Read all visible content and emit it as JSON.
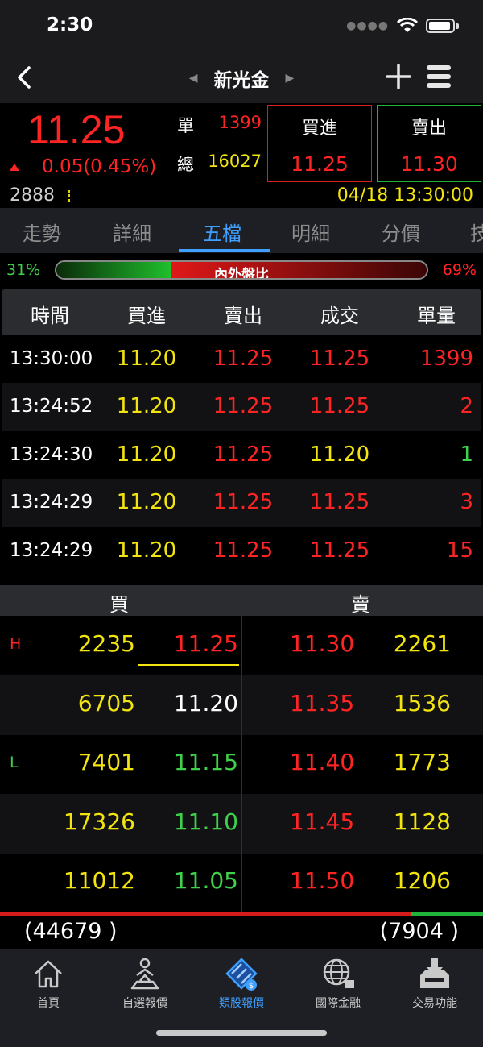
{
  "status": {
    "time": "2:30"
  },
  "header": {
    "title": "新光金"
  },
  "quote": {
    "price": "11.25",
    "change": "0.05(0.45%)",
    "code": "2888",
    "single_label": "單",
    "single_value": "1399",
    "total_label": "總",
    "total_value": "16027",
    "buy_label": "買進",
    "buy_value": "11.25",
    "sell_label": "賣出",
    "sell_value": "11.30",
    "datetime": "04/18 13:30:00"
  },
  "tabs": [
    "走勢",
    "詳細",
    "五檔",
    "明細",
    "分價",
    "技"
  ],
  "active_tab": "五檔",
  "ratio": {
    "inner": "31%",
    "outer": "69%",
    "label": "內外盤比",
    "inner_fraction": 0.31
  },
  "table": {
    "headers": [
      "時間",
      "買進",
      "賣出",
      "成交",
      "單量"
    ],
    "rows": [
      {
        "time": "13:30:00",
        "buy": "11.20",
        "sell": "11.25",
        "deal": "11.25",
        "deal_color": "#ff2424",
        "vol": "1399",
        "vol_color": "#ff2424"
      },
      {
        "time": "13:24:52",
        "buy": "11.20",
        "sell": "11.25",
        "deal": "11.25",
        "deal_color": "#ff2424",
        "vol": "2",
        "vol_color": "#ff2424"
      },
      {
        "time": "13:24:30",
        "buy": "11.20",
        "sell": "11.25",
        "deal": "11.20",
        "deal_color": "#f2e40f",
        "vol": "1",
        "vol_color": "#3fd14a"
      },
      {
        "time": "13:24:29",
        "buy": "11.20",
        "sell": "11.25",
        "deal": "11.25",
        "deal_color": "#ff2424",
        "vol": "3",
        "vol_color": "#ff2424"
      },
      {
        "time": "13:24:29",
        "buy": "11.20",
        "sell": "11.25",
        "deal": "11.25",
        "deal_color": "#ff2424",
        "vol": "15",
        "vol_color": "#ff2424"
      }
    ]
  },
  "book": {
    "buy_label": "買",
    "sell_label": "賣",
    "rows": [
      {
        "tag": "H",
        "tag_color": "#ff2424",
        "bid_vol": "2235",
        "bid_px": "11.25",
        "bid_color": "#ff2424",
        "ask_px": "11.30",
        "ask_vol": "2261"
      },
      {
        "tag": "",
        "tag_color": "#ffffff",
        "bid_vol": "6705",
        "bid_px": "11.20",
        "bid_color": "#ffffff",
        "ask_px": "11.35",
        "ask_vol": "1536"
      },
      {
        "tag": "L",
        "tag_color": "#3fd14a",
        "bid_vol": "7401",
        "bid_px": "11.15",
        "bid_color": "#3fd14a",
        "ask_px": "11.40",
        "ask_vol": "1773"
      },
      {
        "tag": "",
        "tag_color": "#ffffff",
        "bid_vol": "17326",
        "bid_px": "11.10",
        "bid_color": "#3fd14a",
        "ask_px": "11.45",
        "ask_vol": "1128"
      },
      {
        "tag": "",
        "tag_color": "#ffffff",
        "bid_vol": "11012",
        "bid_px": "11.05",
        "bid_color": "#3fd14a",
        "ask_px": "11.50",
        "ask_vol": "1206"
      }
    ],
    "total_bid": "(44679 )",
    "total_ask": "(7904 )",
    "bid_fraction": 0.85
  },
  "nav": [
    {
      "label": "首頁",
      "icon": "home-icon"
    },
    {
      "label": "自選報價",
      "icon": "watchlist-icon"
    },
    {
      "label": "類股報價",
      "icon": "sector-quote-icon"
    },
    {
      "label": "國際金融",
      "icon": "globe-icon"
    },
    {
      "label": "交易功能",
      "icon": "trade-icon"
    }
  ],
  "active_nav": "類股報價",
  "colors": {
    "up": "#ff2424",
    "down": "#3fd14a",
    "flat": "#f2e40f",
    "accent": "#3fa0ff"
  }
}
